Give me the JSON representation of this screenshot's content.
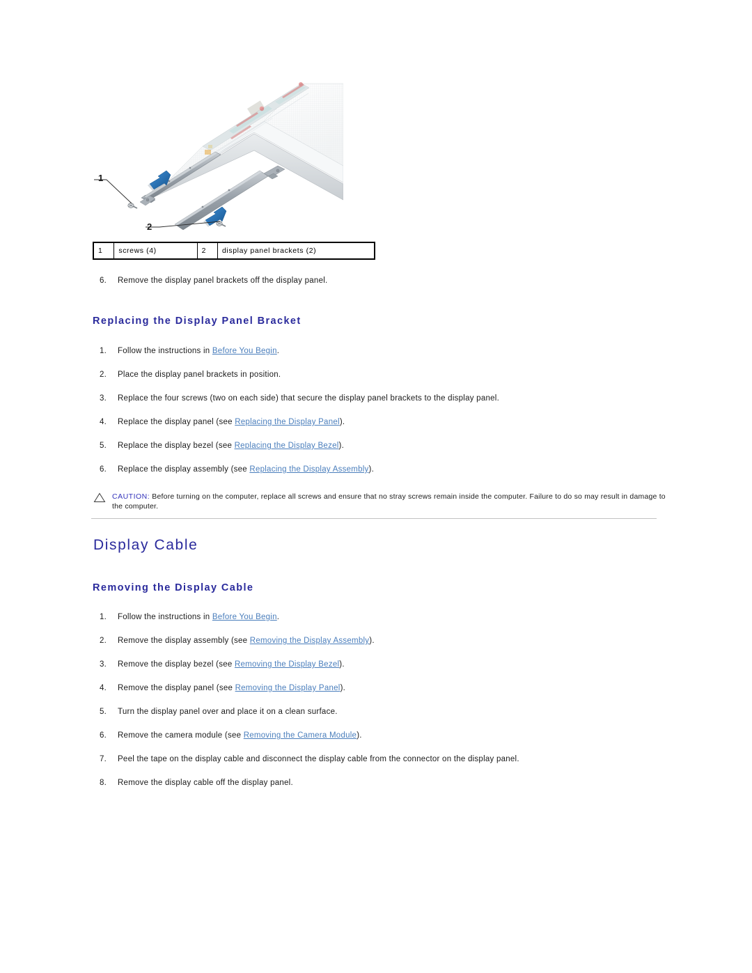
{
  "figure": {
    "alt": "Display panel with two display panel brackets and four screws",
    "callouts": [
      {
        "num": "1",
        "label": "screws (4)"
      },
      {
        "num": "2",
        "label": "display panel brackets (2)"
      }
    ],
    "leader_labels": {
      "one": "1",
      "two": "2"
    },
    "colors": {
      "arrow_blue": "#1f6fc4",
      "bracket_gray": "#9aa3ab",
      "panel_white": "#fdfdfd",
      "label_teal": "#b9dcdc",
      "label_red": "#d06a6a",
      "label_orange": "#e0a03c"
    }
  },
  "pre_table_step": {
    "num": "6.",
    "text": "Remove the display panel brackets off the display panel."
  },
  "section_replace_bracket": {
    "heading": "Replacing the Display Panel Bracket",
    "steps": [
      {
        "num": "1.",
        "pre": "Follow the instructions in ",
        "link": "Before You Begin",
        "post": "."
      },
      {
        "num": "2.",
        "pre": "Place the display panel brackets in position.",
        "link": "",
        "post": ""
      },
      {
        "num": "3.",
        "pre": "Replace the four screws (two on each side) that secure the display panel brackets to the display panel.",
        "link": "",
        "post": ""
      },
      {
        "num": "4.",
        "pre": "Replace the display panel (see ",
        "link": "Replacing the Display Panel",
        "post": ")."
      },
      {
        "num": "5.",
        "pre": "Replace the display bezel (see ",
        "link": "Replacing the Display Bezel",
        "post": ")."
      },
      {
        "num": "6.",
        "pre": "Replace the display assembly (see ",
        "link": "Replacing the Display Assembly",
        "post": ")."
      }
    ]
  },
  "caution": {
    "icon": "warning-triangle-icon",
    "label": "CAUTION:",
    "text": " Before turning on the computer, replace all screws and ensure that no stray screws remain inside the computer. Failure to do so may result in damage to the computer."
  },
  "section_display_cable": {
    "heading": "Display Cable",
    "sub_heading": "Removing the Display Cable",
    "steps": [
      {
        "num": "1.",
        "pre": "Follow the instructions in ",
        "link": "Before You Begin",
        "post": "."
      },
      {
        "num": "2.",
        "pre": "Remove the display assembly (see ",
        "link": "Removing the Display Assembly",
        "post": ")."
      },
      {
        "num": "3.",
        "pre": "Remove the display bezel (see ",
        "link": "Removing the Display Bezel",
        "post": ")."
      },
      {
        "num": "4.",
        "pre": "Remove the display panel (see ",
        "link": "Removing the Display Panel",
        "post": ")."
      },
      {
        "num": "5.",
        "pre": "Turn the display panel over and place it on a clean surface.",
        "link": "",
        "post": ""
      },
      {
        "num": "6.",
        "pre": "Remove the camera module (see ",
        "link": "Removing the Camera Module",
        "post": ")."
      },
      {
        "num": "7.",
        "pre": "Peel the tape on the display cable and disconnect the display cable from the connector on the display panel.",
        "link": "",
        "post": ""
      },
      {
        "num": "8.",
        "pre": "Remove the display cable off the display panel.",
        "link": "",
        "post": ""
      }
    ]
  },
  "theme": {
    "heading_blue": "#2a2a9c",
    "link_blue": "#4a7ebc",
    "caution_blue": "#3333bb",
    "body_black": "#1a1a1a",
    "rule_gray": "#c2c2c2"
  }
}
